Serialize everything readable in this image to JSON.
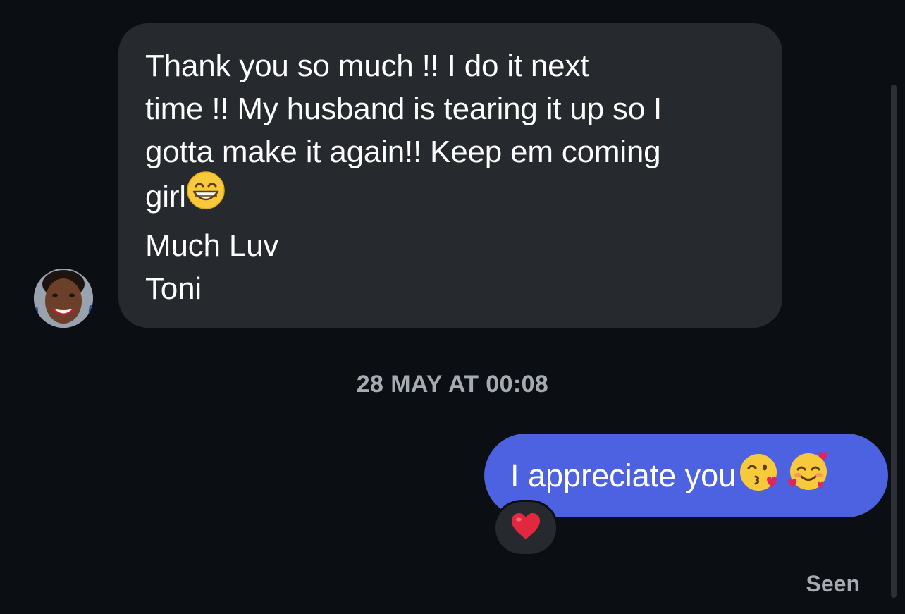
{
  "conversation": {
    "incoming": {
      "lines": [
        "Thank you so much !! I do it next",
        "time !! My husband is tearing it up so I",
        "gotta make it again!! Keep em coming",
        "girl",
        "Much Luv",
        "Toni"
      ],
      "inline_emoji": "grinning-face-with-smiling-eyes"
    },
    "timestamp": "28 MAY AT 00:08",
    "outgoing": {
      "text": "I appreciate you",
      "emojis": [
        "face-blowing-a-kiss",
        "smiling-face-with-hearts"
      ]
    },
    "reaction": {
      "emoji": "red-heart"
    },
    "status": "Seen"
  },
  "colors": {
    "background": "#0b0e12",
    "incoming_bubble": "#26292e",
    "outgoing_bubble": "#4c62e0",
    "meta_text": "#a6abb3"
  }
}
